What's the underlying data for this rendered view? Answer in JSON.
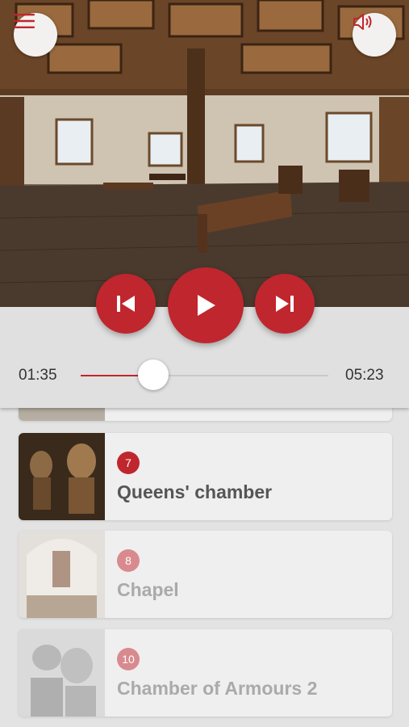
{
  "hero": {
    "menu_icon": "hamburger-menu-icon",
    "sound_icon": "speaker-icon"
  },
  "player": {
    "current_time": "01:35",
    "total_time": "05:23",
    "progress": 0.294,
    "prev_icon": "skip-previous-icon",
    "play_icon": "play-icon",
    "next_icon": "skip-next-icon"
  },
  "colors": {
    "accent": "#c0262d",
    "accent_muted": "#d98a8e",
    "background": "#e3e3e3"
  },
  "list": {
    "items": [
      {
        "number": "7",
        "title": "Queens' chamber",
        "active": true
      },
      {
        "number": "8",
        "title": "Chapel",
        "active": false
      },
      {
        "number": "10",
        "title": "Chamber of Armours 2",
        "active": false
      }
    ]
  }
}
